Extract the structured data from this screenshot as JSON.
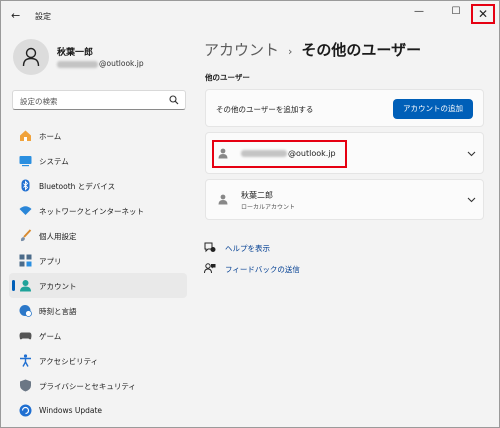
{
  "app": {
    "title": "設定"
  },
  "user": {
    "name": "秋葉一郎",
    "email_suffix": "@outlook.jp"
  },
  "search": {
    "placeholder": "設定の検索"
  },
  "nav": {
    "items": [
      {
        "label": "ホーム",
        "icon": "home-icon"
      },
      {
        "label": "システム",
        "icon": "system-icon"
      },
      {
        "label": "Bluetooth とデバイス",
        "icon": "bluetooth-icon"
      },
      {
        "label": "ネットワークとインターネット",
        "icon": "wifi-icon"
      },
      {
        "label": "個人用設定",
        "icon": "brush-icon"
      },
      {
        "label": "アプリ",
        "icon": "apps-icon"
      },
      {
        "label": "アカウント",
        "icon": "account-icon",
        "active": true
      },
      {
        "label": "時刻と言語",
        "icon": "globe-clock-icon"
      },
      {
        "label": "ゲーム",
        "icon": "gamepad-icon"
      },
      {
        "label": "アクセシビリティ",
        "icon": "accessibility-icon"
      },
      {
        "label": "プライバシーとセキュリティ",
        "icon": "shield-icon"
      },
      {
        "label": "Windows Update",
        "icon": "update-icon"
      }
    ]
  },
  "breadcrumb": {
    "parent": "アカウント",
    "separator": "›",
    "current": "その他のユーザー"
  },
  "other_users": {
    "section_label": "他のユーザー",
    "add_text": "その他のユーザーを追加する",
    "add_button": "アカウントの追加",
    "users": [
      {
        "email_suffix": "@outlook.jp"
      },
      {
        "name": "秋葉二郎",
        "type": "ローカルアカウント"
      }
    ]
  },
  "links": {
    "help": "ヘルプを表示",
    "feedback": "フィードバックの送信"
  },
  "colors": {
    "accent": "#005fb8",
    "highlight": "#e60012"
  }
}
